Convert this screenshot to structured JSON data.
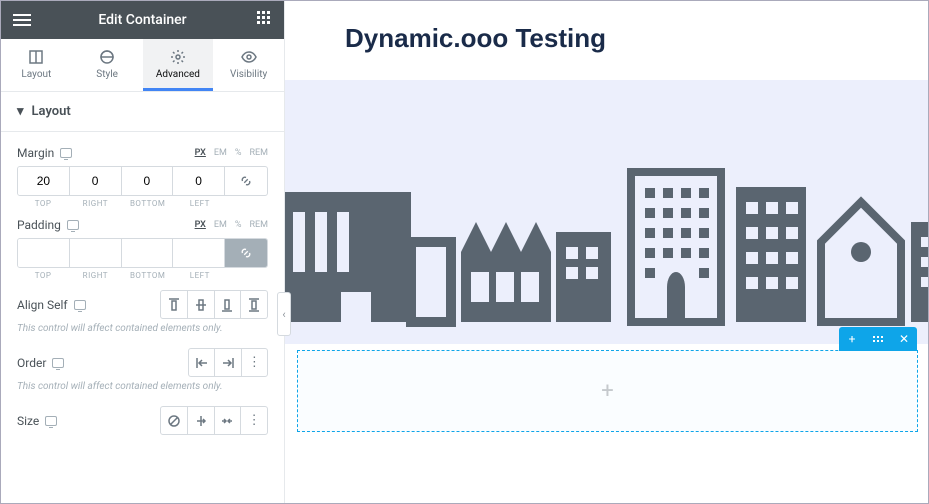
{
  "header": {
    "title": "Edit Container"
  },
  "tabs": [
    {
      "label": "Layout"
    },
    {
      "label": "Style"
    },
    {
      "label": "Advanced"
    },
    {
      "label": "Visibility"
    }
  ],
  "activeTab": 2,
  "section": {
    "title": "Layout"
  },
  "margin": {
    "label": "Margin",
    "units": [
      "PX",
      "EM",
      "%",
      "REM"
    ],
    "activeUnit": "PX",
    "values": {
      "top": "20",
      "right": "0",
      "bottom": "0",
      "left": "0"
    },
    "sublabels": [
      "TOP",
      "RIGHT",
      "BOTTOM",
      "LEFT"
    ],
    "linked": false
  },
  "padding": {
    "label": "Padding",
    "units": [
      "PX",
      "EM",
      "%",
      "REM"
    ],
    "activeUnit": "PX",
    "values": {
      "top": "",
      "right": "",
      "bottom": "",
      "left": ""
    },
    "sublabels": [
      "TOP",
      "RIGHT",
      "BOTTOM",
      "LEFT"
    ],
    "linked": true
  },
  "alignSelf": {
    "label": "Align Self"
  },
  "order": {
    "label": "Order"
  },
  "size": {
    "label": "Size"
  },
  "helpText": "This control will affect contained elements only.",
  "canvas": {
    "heading": "Dynamic.ooo Testing"
  },
  "colors": {
    "accent": "#0ea5e9",
    "brand": "#4285f4",
    "skyline": "#5a6570",
    "band": "#eceffc"
  }
}
